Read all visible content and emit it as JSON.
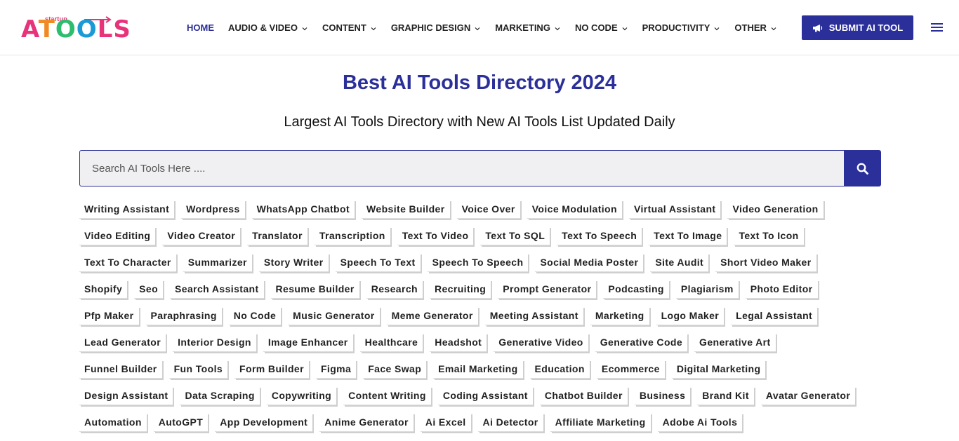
{
  "logo": {
    "small_text": "startup",
    "letters": [
      "A",
      "T",
      "O",
      "O",
      "LS"
    ]
  },
  "nav": {
    "items": [
      {
        "label": "HOME",
        "dropdown": false,
        "active": true
      },
      {
        "label": "AUDIO & VIDEO",
        "dropdown": true
      },
      {
        "label": "CONTENT",
        "dropdown": true
      },
      {
        "label": "GRAPHIC DESIGN",
        "dropdown": true
      },
      {
        "label": "MARKETING",
        "dropdown": true
      },
      {
        "label": "NO CODE",
        "dropdown": true
      },
      {
        "label": "PRODUCTIVITY",
        "dropdown": true
      },
      {
        "label": "OTHER",
        "dropdown": true
      }
    ],
    "submit_label": "SUBMIT AI TOOL"
  },
  "hero": {
    "title": "Best AI Tools Directory 2024",
    "subtitle": "Largest AI Tools Directory with New AI Tools List Updated Daily"
  },
  "search": {
    "placeholder": "Search AI Tools Here ...."
  },
  "tag_rows": [
    [
      "Writing Assistant",
      "Wordpress",
      "WhatsApp Chatbot",
      "Website Builder",
      "Voice Over",
      "Voice Modulation",
      "Virtual Assistant",
      "Video Generation"
    ],
    [
      "Video Editing",
      "Video Creator",
      "Translator",
      "Transcription",
      "Text To Video",
      "Text To SQL",
      "Text To Speech",
      "Text To Image",
      "Text To Icon"
    ],
    [
      "Text To Character",
      "Summarizer",
      "Story Writer",
      "Speech To Text",
      "Speech To Speech",
      "Social Media Poster",
      "Site Audit",
      "Short Video Maker"
    ],
    [
      "Shopify",
      "Seo",
      "Search Assistant",
      "Resume Builder",
      "Research",
      "Recruiting",
      "Prompt Generator",
      "Podcasting",
      "Plagiarism",
      "Photo Editor"
    ],
    [
      "Pfp Maker",
      "Paraphrasing",
      "No Code",
      "Music Generator",
      "Meme Generator",
      "Meeting Assistant",
      "Marketing",
      "Logo Maker",
      "Legal Assistant"
    ],
    [
      "Lead Generator",
      "Interior Design",
      "Image Enhancer",
      "Healthcare",
      "Headshot",
      "Generative Video",
      "Generative Code",
      "Generative Art"
    ],
    [
      "Funnel Builder",
      "Fun Tools",
      "Form Builder",
      "Figma",
      "Face Swap",
      "Email Marketing",
      "Education",
      "Ecommerce",
      "Digital Marketing"
    ],
    [
      "Design Assistant",
      "Data Scraping",
      "Copywriting",
      "Content Writing",
      "Coding Assistant",
      "Chatbot Builder",
      "Business",
      "Brand Kit",
      "Avatar Generator"
    ],
    [
      "Automation",
      "AutoGPT",
      "App Development",
      "Anime Generator",
      "Ai Excel",
      "Ai Detector",
      "Affiliate Marketing",
      "Adobe Ai Tools"
    ]
  ],
  "colors": {
    "primary": "#2b2f99",
    "logo_pink": "#e8327a",
    "logo_orange": "#f08a24",
    "logo_green": "#2dbd6e",
    "logo_blue": "#1b9ad6"
  },
  "icons": {
    "submit": "bullhorn-icon",
    "search": "search-icon",
    "menu": "hamburger-menu-icon",
    "dropdown": "chevron-down-icon"
  }
}
